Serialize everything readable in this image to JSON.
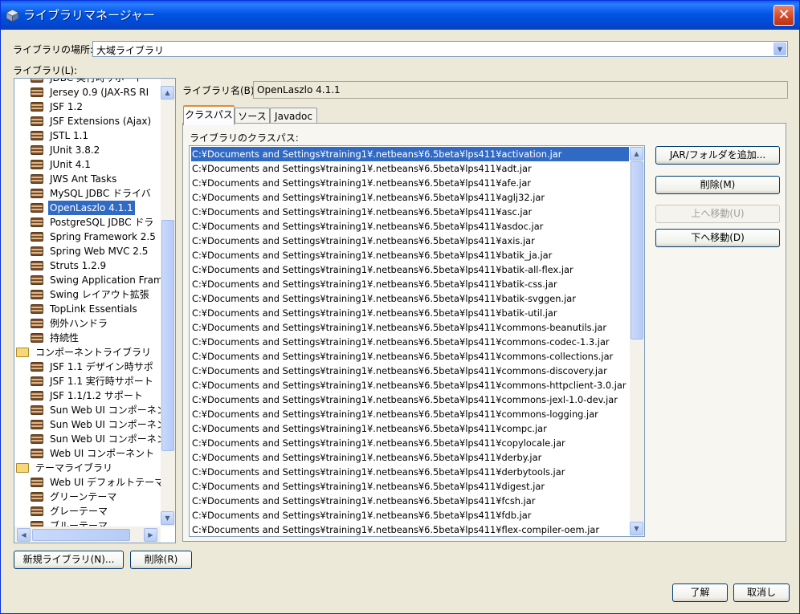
{
  "window": {
    "title": "ライブラリマネージャー",
    "close_glyph": "✕"
  },
  "location": {
    "label": "ライブラリの場所:",
    "value": "大域ライブラリ"
  },
  "libraries_label": "ライブラリ(L):",
  "tree": [
    {
      "label": "JDBC 実行時サポート",
      "icon": "jar-icon"
    },
    {
      "label": "Jersey 0.9 (JAX-RS RI",
      "icon": "jar-icon"
    },
    {
      "label": "JSF 1.2",
      "icon": "jar-icon"
    },
    {
      "label": "JSF Extensions (Ajax)",
      "icon": "jar-icon"
    },
    {
      "label": "JSTL 1.1",
      "icon": "jar-icon"
    },
    {
      "label": "JUnit 3.8.2",
      "icon": "jar-icon"
    },
    {
      "label": "JUnit 4.1",
      "icon": "jar-icon"
    },
    {
      "label": "JWS Ant Tasks",
      "icon": "jar-icon"
    },
    {
      "label": "MySQL JDBC ドライバ",
      "icon": "jar-icon"
    },
    {
      "label": "OpenLaszlo 4.1.1",
      "icon": "jar-icon",
      "selected": true
    },
    {
      "label": "PostgreSQL JDBC ドラ",
      "icon": "jar-icon"
    },
    {
      "label": "Spring Framework 2.5",
      "icon": "jar-icon"
    },
    {
      "label": "Spring Web MVC 2.5",
      "icon": "jar-icon"
    },
    {
      "label": "Struts 1.2.9",
      "icon": "jar-icon"
    },
    {
      "label": "Swing Application Fram",
      "icon": "jar-icon"
    },
    {
      "label": "Swing レイアウト拡張",
      "icon": "jar-icon"
    },
    {
      "label": "TopLink Essentials",
      "icon": "jar-icon"
    },
    {
      "label": "例外ハンドラ",
      "icon": "jar-icon"
    },
    {
      "label": "持続性",
      "icon": "jar-icon"
    },
    {
      "label": "コンポーネントライブラリ",
      "icon": "folder-icon",
      "folder": true
    },
    {
      "label": "JSF 1.1 デザイン時サポ",
      "icon": "jar-icon"
    },
    {
      "label": "JSF 1.1 実行時サポート",
      "icon": "jar-icon"
    },
    {
      "label": "JSF 1.1/1.2 サポート",
      "icon": "jar-icon"
    },
    {
      "label": "Sun Web UI コンポーネン",
      "icon": "jar-icon"
    },
    {
      "label": "Sun Web UI コンポーネン",
      "icon": "jar-icon"
    },
    {
      "label": "Sun Web UI コンポーネン",
      "icon": "jar-icon"
    },
    {
      "label": "Web UI コンポーネント",
      "icon": "jar-icon"
    },
    {
      "label": "テーマライブラリ",
      "icon": "folder-icon",
      "folder": true
    },
    {
      "label": "Web UI デフォルトテーマ",
      "icon": "jar-icon"
    },
    {
      "label": "グリーンテーマ",
      "icon": "jar-icon"
    },
    {
      "label": "グレーテーマ",
      "icon": "jar-icon"
    },
    {
      "label": "ブルーテーマ",
      "icon": "jar-icon"
    }
  ],
  "library_name": {
    "label": "ライブラリ名(B):",
    "value": "OpenLaszlo 4.1.1"
  },
  "tabs": [
    "クラスパス",
    "ソース",
    "Javadoc"
  ],
  "classpath_label": "ライブラリのクラスパス:",
  "classpath": [
    "C:¥Documents and Settings¥training1¥.netbeans¥6.5beta¥lps411¥activation.jar",
    "C:¥Documents and Settings¥training1¥.netbeans¥6.5beta¥lps411¥adt.jar",
    "C:¥Documents and Settings¥training1¥.netbeans¥6.5beta¥lps411¥afe.jar",
    "C:¥Documents and Settings¥training1¥.netbeans¥6.5beta¥lps411¥aglj32.jar",
    "C:¥Documents and Settings¥training1¥.netbeans¥6.5beta¥lps411¥asc.jar",
    "C:¥Documents and Settings¥training1¥.netbeans¥6.5beta¥lps411¥asdoc.jar",
    "C:¥Documents and Settings¥training1¥.netbeans¥6.5beta¥lps411¥axis.jar",
    "C:¥Documents and Settings¥training1¥.netbeans¥6.5beta¥lps411¥batik_ja.jar",
    "C:¥Documents and Settings¥training1¥.netbeans¥6.5beta¥lps411¥batik-all-flex.jar",
    "C:¥Documents and Settings¥training1¥.netbeans¥6.5beta¥lps411¥batik-css.jar",
    "C:¥Documents and Settings¥training1¥.netbeans¥6.5beta¥lps411¥batik-svggen.jar",
    "C:¥Documents and Settings¥training1¥.netbeans¥6.5beta¥lps411¥batik-util.jar",
    "C:¥Documents and Settings¥training1¥.netbeans¥6.5beta¥lps411¥commons-beanutils.jar",
    "C:¥Documents and Settings¥training1¥.netbeans¥6.5beta¥lps411¥commons-codec-1.3.jar",
    "C:¥Documents and Settings¥training1¥.netbeans¥6.5beta¥lps411¥commons-collections.jar",
    "C:¥Documents and Settings¥training1¥.netbeans¥6.5beta¥lps411¥commons-discovery.jar",
    "C:¥Documents and Settings¥training1¥.netbeans¥6.5beta¥lps411¥commons-httpclient-3.0.jar",
    "C:¥Documents and Settings¥training1¥.netbeans¥6.5beta¥lps411¥commons-jexl-1.0-dev.jar",
    "C:¥Documents and Settings¥training1¥.netbeans¥6.5beta¥lps411¥commons-logging.jar",
    "C:¥Documents and Settings¥training1¥.netbeans¥6.5beta¥lps411¥compc.jar",
    "C:¥Documents and Settings¥training1¥.netbeans¥6.5beta¥lps411¥copylocale.jar",
    "C:¥Documents and Settings¥training1¥.netbeans¥6.5beta¥lps411¥derby.jar",
    "C:¥Documents and Settings¥training1¥.netbeans¥6.5beta¥lps411¥derbytools.jar",
    "C:¥Documents and Settings¥training1¥.netbeans¥6.5beta¥lps411¥digest.jar",
    "C:¥Documents and Settings¥training1¥.netbeans¥6.5beta¥lps411¥fcsh.jar",
    "C:¥Documents and Settings¥training1¥.netbeans¥6.5beta¥lps411¥fdb.jar",
    "C:¥Documents and Settings¥training1¥.netbeans¥6.5beta¥lps411¥flex-compiler-oem.jar"
  ],
  "side_buttons": {
    "add": "JAR/フォルダを追加...",
    "remove": "削除(M)",
    "up": "上へ移動(U)",
    "down": "下へ移動(D)"
  },
  "bottom_buttons": {
    "new_library": "新規ライブラリ(N)...",
    "delete": "削除(R)",
    "ok": "了解",
    "cancel": "取消し"
  },
  "colors": {
    "selection": "#316ac5",
    "titlebar": "#0055e5",
    "dialog_bg": "#ece9d8"
  }
}
